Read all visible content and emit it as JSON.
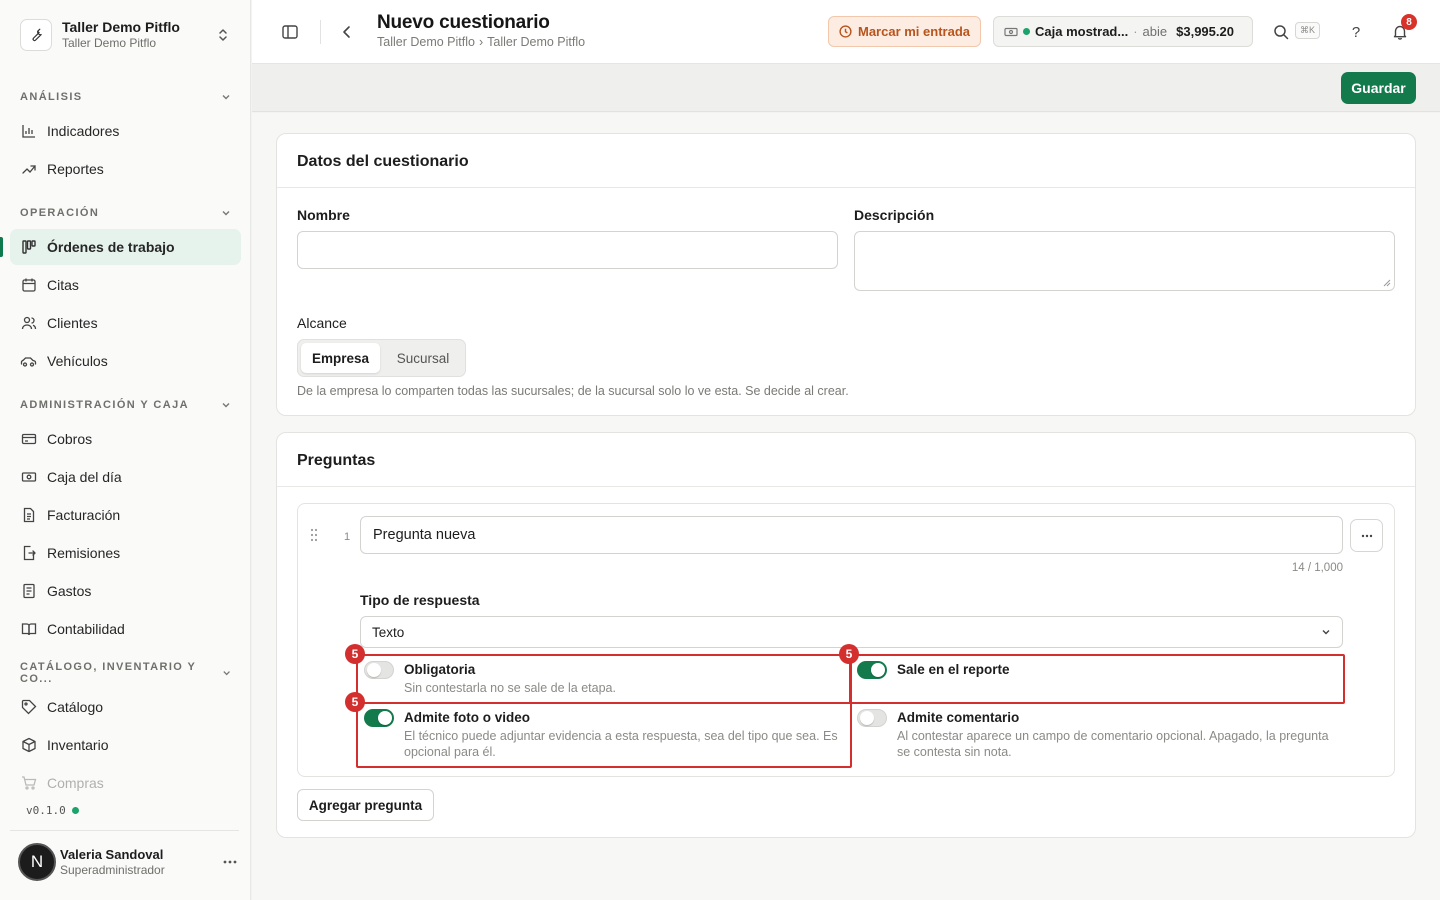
{
  "org": {
    "name": "Taller Demo Pitflo",
    "subtitle": "Taller Demo Pitflo"
  },
  "sidebar": {
    "sections": [
      {
        "title": "ANÁLISIS",
        "items": [
          {
            "label": "Indicadores",
            "icon": "bar-chart-icon"
          },
          {
            "label": "Reportes",
            "icon": "trend-icon"
          }
        ]
      },
      {
        "title": "OPERACIÓN",
        "items": [
          {
            "label": "Órdenes de trabajo",
            "icon": "kanban-icon",
            "active": true
          },
          {
            "label": "Citas",
            "icon": "calendar-icon"
          },
          {
            "label": "Clientes",
            "icon": "users-icon"
          },
          {
            "label": "Vehículos",
            "icon": "car-icon"
          }
        ]
      },
      {
        "title": "ADMINISTRACIÓN Y CAJA",
        "items": [
          {
            "label": "Cobros",
            "icon": "credit-card-icon"
          },
          {
            "label": "Caja del día",
            "icon": "cash-icon"
          },
          {
            "label": "Facturación",
            "icon": "invoice-icon"
          },
          {
            "label": "Remisiones",
            "icon": "file-export-icon"
          },
          {
            "label": "Gastos",
            "icon": "receipt-icon"
          },
          {
            "label": "Contabilidad",
            "icon": "book-icon"
          }
        ]
      },
      {
        "title": "CATÁLOGO, INVENTARIO Y CO...",
        "items": [
          {
            "label": "Catálogo",
            "icon": "tag-icon"
          },
          {
            "label": "Inventario",
            "icon": "box-icon"
          },
          {
            "label": "Compras",
            "icon": "cart-icon"
          }
        ]
      }
    ],
    "version": "v0.1.0",
    "user": {
      "initial": "N",
      "name": "Valeria Sandoval",
      "role": "Superadministrador"
    }
  },
  "header": {
    "title": "Nuevo cuestionario",
    "breadcrumb": [
      "Taller Demo Pitflo",
      "›",
      "Taller Demo Pitflo"
    ],
    "checkin_label": "Marcar mi entrada",
    "cash": {
      "name": "Caja mostrad...",
      "separator": "·",
      "status": "abie",
      "amount": "$3,995.20"
    },
    "search_shortcut": "⌘K",
    "help": "?",
    "notification_count": "8"
  },
  "actions": {
    "save_label": "Guardar"
  },
  "form": {
    "section_title": "Datos del cuestionario",
    "name_label": "Nombre",
    "name_value": "",
    "description_label": "Descripción",
    "description_value": "",
    "scope_label": "Alcance",
    "scope_options": [
      "Empresa",
      "Sucursal"
    ],
    "scope_selected": "Empresa",
    "scope_hint": "De la empresa lo comparten todas las sucursales; de la sucursal solo lo ve esta. Se decide al crear."
  },
  "questions": {
    "section_title": "Preguntas",
    "items": [
      {
        "number": "1",
        "text": "Pregunta nueva",
        "char_count": "14 / 1,000",
        "type_label": "Tipo de respuesta",
        "type_value": "Texto",
        "options": [
          {
            "title": "Obligatoria",
            "description": "Sin contestarla no se sale de la etapa.",
            "enabled": false
          },
          {
            "title": "Sale en el reporte",
            "description": "",
            "enabled": true
          },
          {
            "title": "Admite foto o video",
            "description": "El técnico puede adjuntar evidencia a esta respuesta, sea del tipo que sea. Es opcional para él.",
            "enabled": true
          },
          {
            "title": "Admite comentario",
            "description": "Al contestar aparece un campo de comentario opcional. Apagado, la pregunta se contesta sin nota.",
            "enabled": false
          }
        ]
      }
    ],
    "add_label": "Agregar pregunta"
  },
  "annotations": {
    "highlight_marker": "5",
    "highlight_color": "#d32f2f"
  },
  "colors": {
    "brand": "#137a4c",
    "active_bg": "#e6f3ec",
    "checkin_bg": "#fcece1",
    "checkin_text": "#b8541c",
    "badge": "#d8322a"
  }
}
